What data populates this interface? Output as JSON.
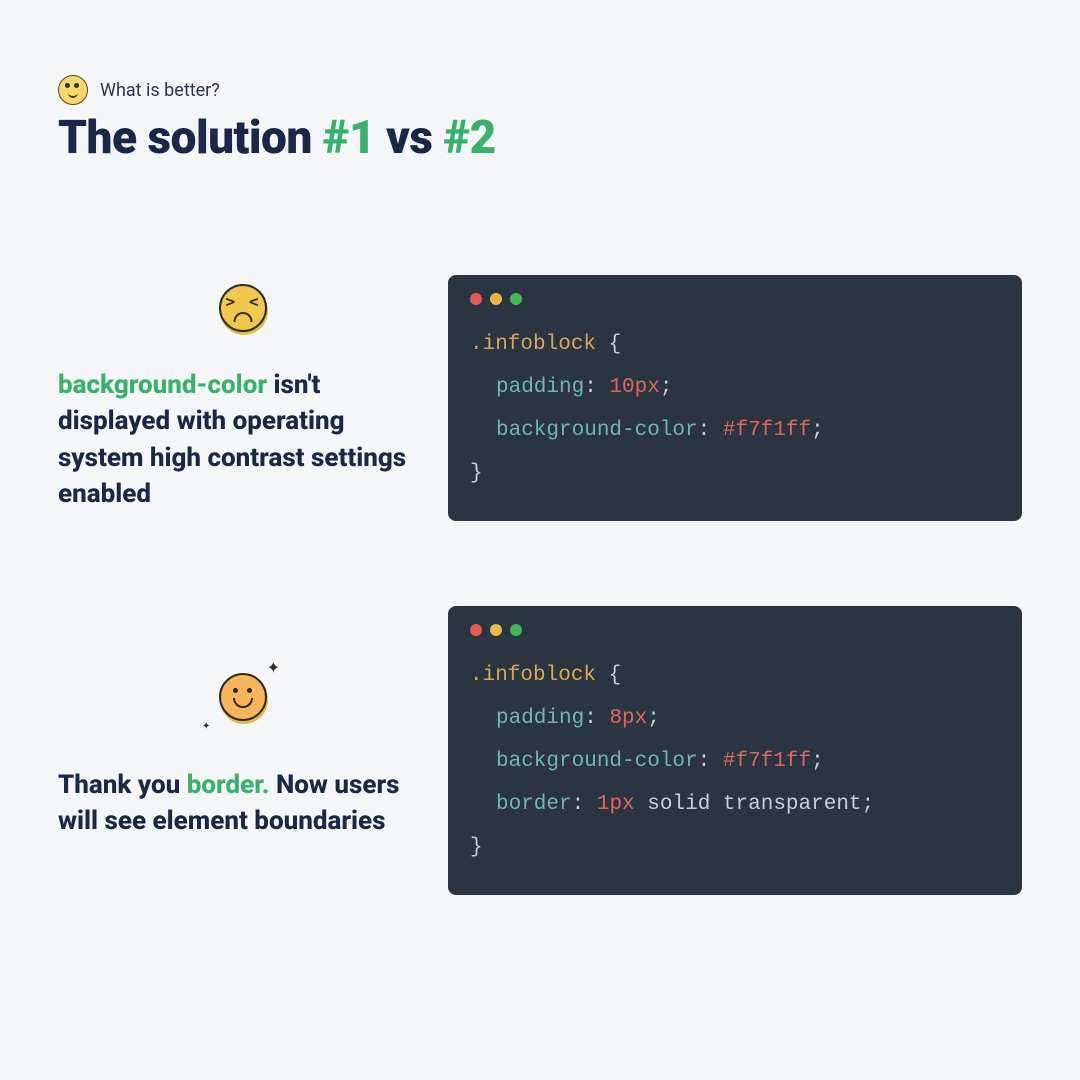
{
  "header": {
    "subtitle": "What is better?",
    "title_part1": "The solution ",
    "title_hash1": "#1",
    "title_mid": "  vs ",
    "title_hash2": "#2"
  },
  "section1": {
    "emoji": "weary-face",
    "desc_highlight": "background-color",
    "desc_rest": "  isn't displayed with operating system high contrast settings enabled",
    "code": {
      "selector": ".infoblock",
      "lines": [
        {
          "prop": "padding",
          "value_num": "10",
          "value_unit": "px"
        },
        {
          "prop": "background-color",
          "value_color": "#f7f1ff"
        }
      ]
    }
  },
  "section2": {
    "emoji": "smiling-face",
    "desc_pre": "Thank you ",
    "desc_highlight": "border.",
    "desc_rest": "  Now users will see element boundaries",
    "code": {
      "selector": ".infoblock",
      "lines": [
        {
          "prop": "padding",
          "value_num": "8",
          "value_unit": "px"
        },
        {
          "prop": "background-color",
          "value_color": "#f7f1ff"
        },
        {
          "prop": "border",
          "value_num": "1",
          "value_unit": "px",
          "value_ident1": "solid",
          "value_ident2": "transparent"
        }
      ]
    }
  }
}
